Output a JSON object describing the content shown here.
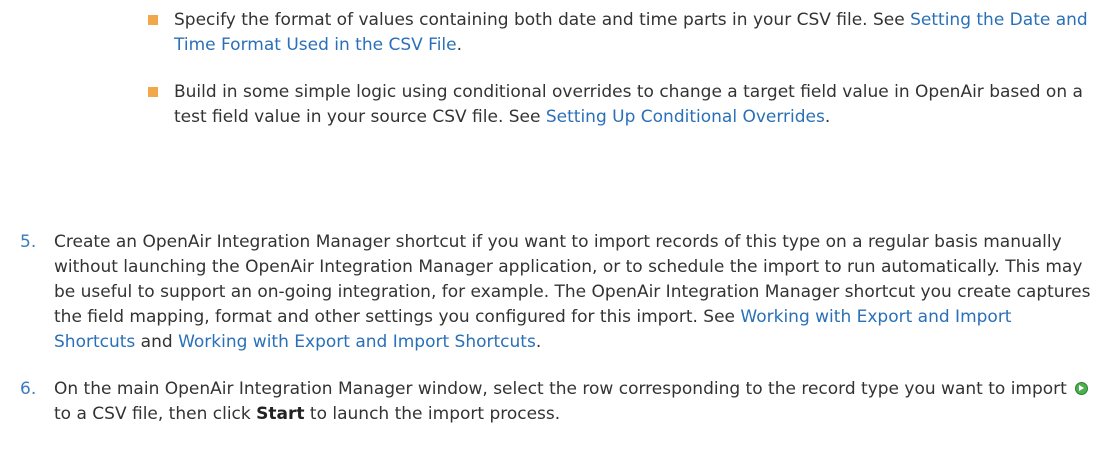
{
  "bullets": [
    {
      "text": "Specify the format of values containing both date and time parts in your CSV file. See ",
      "link": "Setting the Date and Time Format Used in the CSV File",
      "after": "."
    },
    {
      "text": "Build in some simple logic using conditional overrides to change a target field value in OpenAir based on a test field value in your source CSV file. See ",
      "link": "Setting Up Conditional Overrides",
      "after": "."
    }
  ],
  "steps": [
    {
      "num": "5.",
      "text": "Create an OpenAir Integration Manager shortcut if you want to import records of this type on a regular basis manually without launching the OpenAir Integration Manager application, or to schedule the import to run automatically. This may be useful to support an on-going integration, for example. The OpenAir Integration Manager shortcut you create captures the field mapping, format and other settings you configured for this import. See ",
      "link1": "Working with Export and Import Shortcuts",
      "and": " and ",
      "link2": "Working with Export and Import Shortcuts",
      "after": "."
    },
    {
      "num": "6.",
      "before": "On the main OpenAir Integration Manager window, select the row corresponding to the record type you want to import ",
      "middle": " to a CSV file, then click ",
      "bold": "Start",
      "after": " to launch the import process.",
      "icon": "import-start-icon"
    }
  ]
}
